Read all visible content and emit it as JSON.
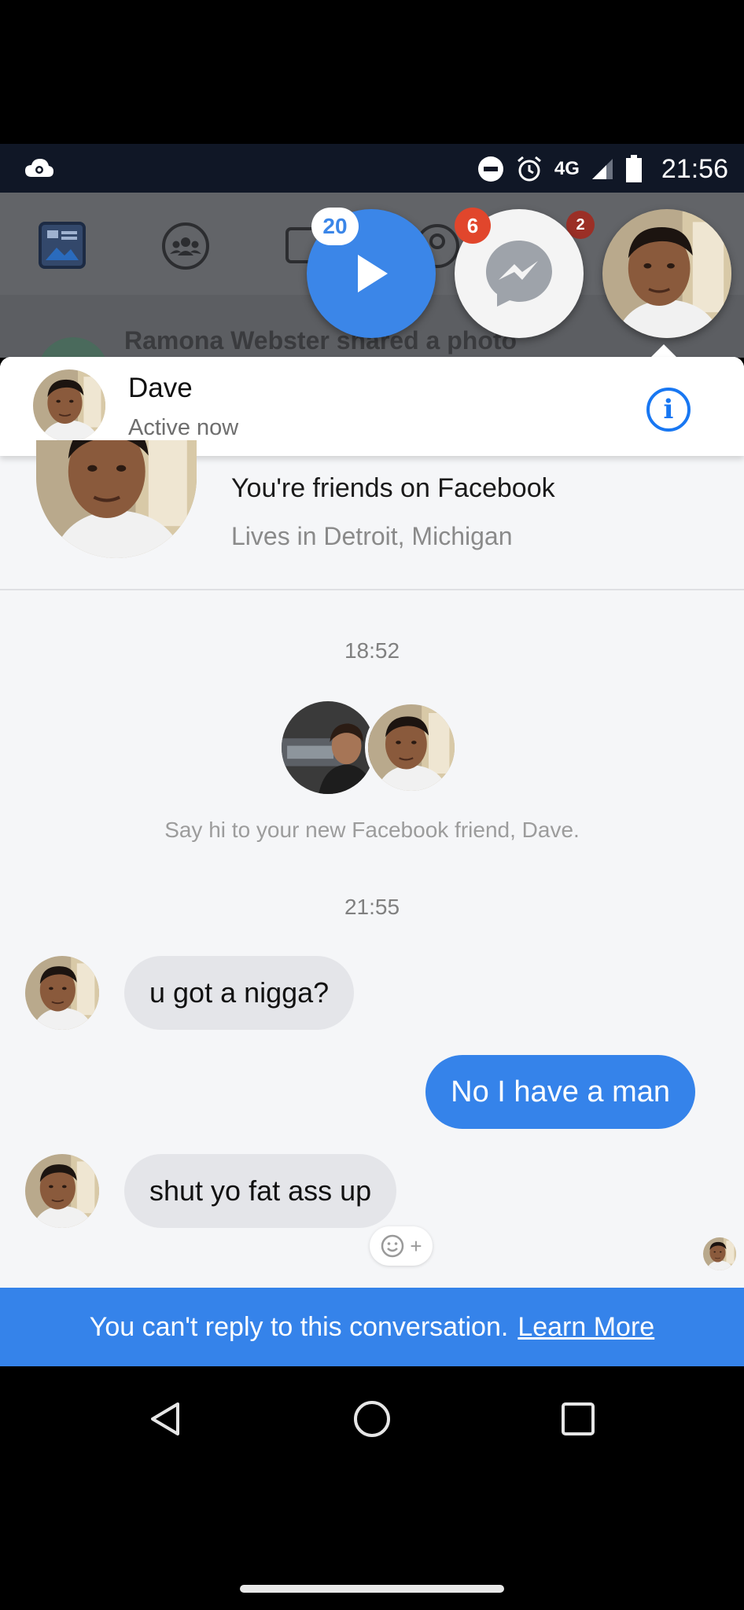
{
  "status_bar": {
    "time": "21:56",
    "network": "4G",
    "icons": [
      "cloud-sync-icon",
      "do-not-disturb-icon",
      "alarm-icon",
      "signal-icon",
      "battery-icon"
    ]
  },
  "facebook": {
    "background_story": "Ramona Webster shared a photo",
    "tabs": [
      "news-feed-icon",
      "groups-icon",
      "watch-icon",
      "friends-icon",
      "notifications-icon",
      "menu-icon"
    ]
  },
  "chat_heads": {
    "video_badge": "20",
    "messenger_badge": "6",
    "hidden_badge": "2"
  },
  "chat": {
    "name": "Dave",
    "status": "Active now",
    "intro_line1": "You're friends on Facebook",
    "intro_line2": "Lives in Detroit, Michigan",
    "time1": "18:52",
    "say_hi": "Say hi to your new Facebook friend, Dave.",
    "time2": "21:55",
    "messages": [
      {
        "from": "them",
        "text": "u got a nigga?"
      },
      {
        "from": "me",
        "text": "No I have a man"
      },
      {
        "from": "them",
        "text": "shut yo fat ass up"
      }
    ]
  },
  "banner": {
    "text": "You can't reply to this conversation.",
    "link": "Learn More"
  },
  "colors": {
    "accent": "#1877f2",
    "bubble_out": "#3583ea",
    "bubble_in": "#e4e5e9",
    "status_bar": "#101726"
  }
}
